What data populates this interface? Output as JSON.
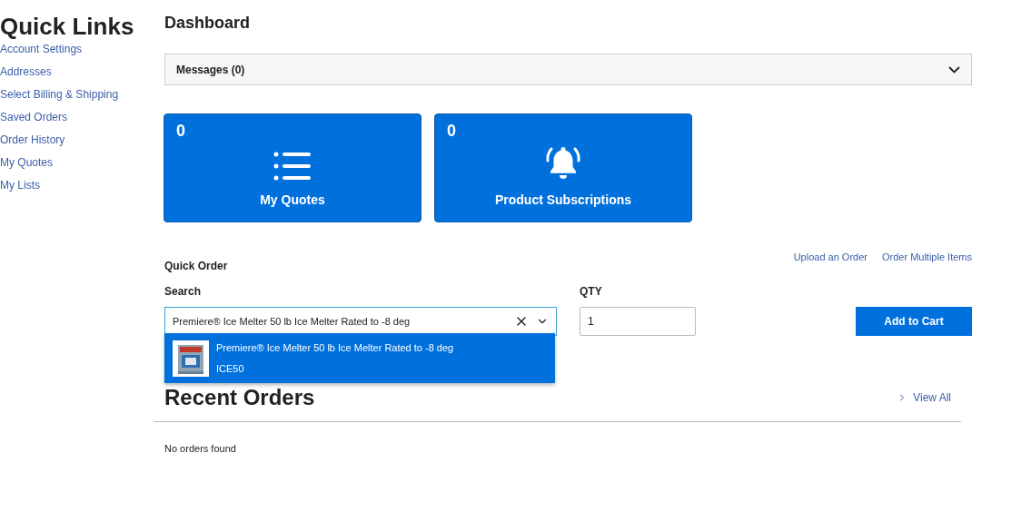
{
  "sidebar": {
    "title": "Quick Links",
    "items": [
      "Account Settings",
      "Addresses",
      "Select Billing & Shipping",
      "Saved Orders",
      "Order History",
      "My Quotes",
      "My Lists"
    ]
  },
  "page_title": "Dashboard",
  "messages": {
    "label": "Messages (0)",
    "expanded": false
  },
  "tiles": [
    {
      "kind": "quotes",
      "count": "0",
      "label": "My Quotes"
    },
    {
      "kind": "subscriptions",
      "count": "0",
      "label": "Product Subscriptions"
    }
  ],
  "quick_order": {
    "title": "Quick Order",
    "links": [
      "Upload an Order",
      "Order Multiple Items"
    ],
    "search_label": "Search",
    "search_value": "Premiere® Ice Melter 50 lb Ice Melter Rated to -8 deg",
    "qty_label": "QTY",
    "qty_value": "1",
    "button": "Add to Cart",
    "suggestions": [
      {
        "name": "Premiere® Ice Melter 50 lb Ice Melter Rated to -8 deg",
        "sku": "ICE50",
        "selected": true
      }
    ]
  },
  "recent_orders": {
    "title": "Recent Orders",
    "view_all": "View All",
    "empty": "No orders found"
  }
}
